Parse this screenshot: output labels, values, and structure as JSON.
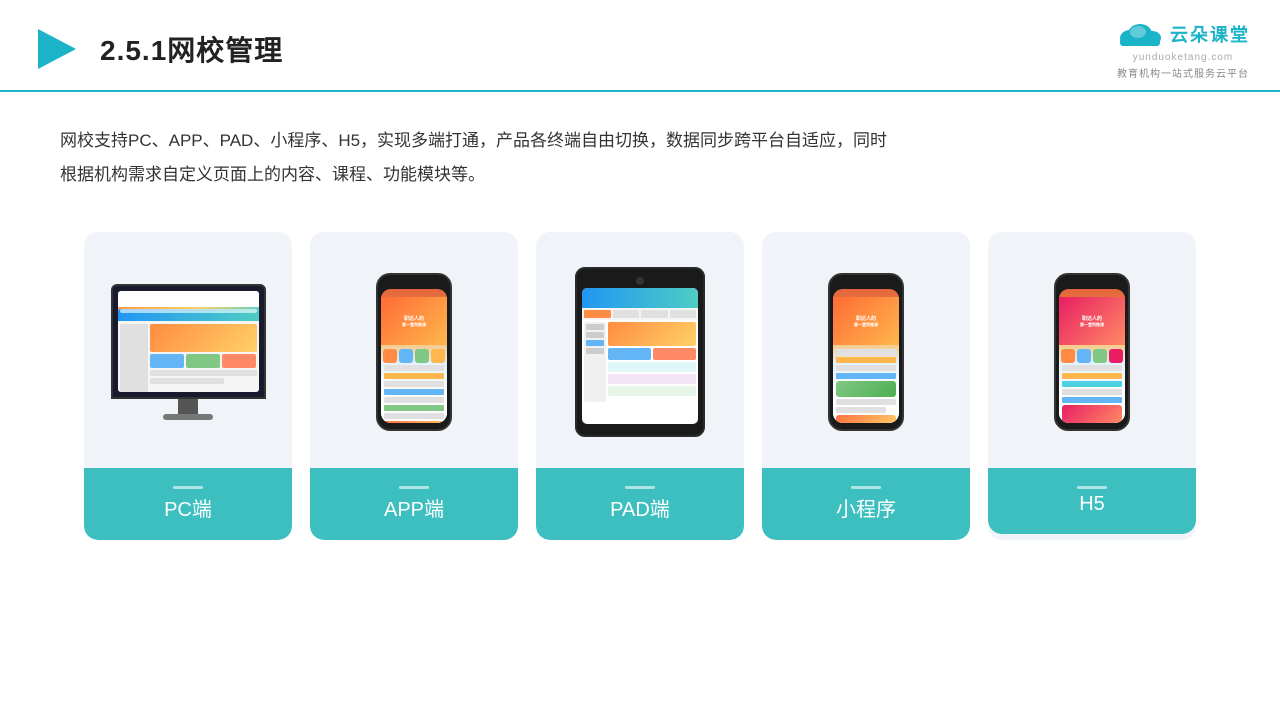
{
  "header": {
    "title": "2.5.1网校管理",
    "logo_text": "云朵课堂",
    "logo_url": "yunduoketang.com",
    "logo_sub": "教育机构一站式服务云平台"
  },
  "description": "网校支持PC、APP、PAD、小程序、H5，实现多端打通，产品各终端自由切换，数据同步跨平台自适应，同时根据机构需求自定义页面上的内容、课程、功能模块等。",
  "cards": [
    {
      "label": "PC端",
      "type": "pc"
    },
    {
      "label": "APP端",
      "type": "phone"
    },
    {
      "label": "PAD端",
      "type": "tablet"
    },
    {
      "label": "小程序",
      "type": "phone_mini"
    },
    {
      "label": "H5",
      "type": "phone_mini2"
    }
  ],
  "accent_color": "#3dbfbf"
}
